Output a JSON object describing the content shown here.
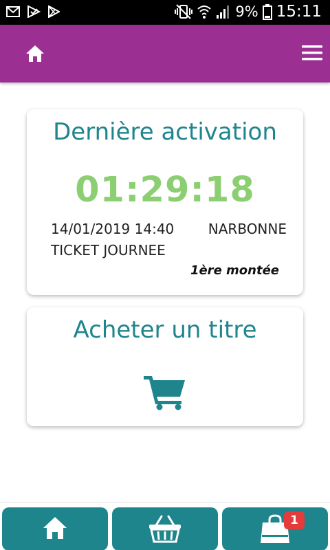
{
  "status_bar": {
    "battery_percent": "9%",
    "time": "15:11",
    "icons": [
      "gmail-icon",
      "play-store-check-icon",
      "play-store-icon",
      "vibrate-icon",
      "wifi-icon",
      "signal-icon",
      "battery-low-icon"
    ]
  },
  "header": {
    "background_color": "#9b2f92",
    "icons": [
      "home-icon",
      "menu-icon"
    ]
  },
  "activation_card": {
    "title": "Dernière activation",
    "timer": "01:29:18",
    "datetime": "14/01/2019 14:40",
    "city": "NARBONNE",
    "ticket_type": "TICKET JOURNEE",
    "boarding": "1ère montée"
  },
  "purchase_card": {
    "title": "Acheter un titre",
    "icon": "cart-icon"
  },
  "bottom_nav": {
    "accent_color": "#1f858c",
    "items": [
      {
        "icon": "home-icon"
      },
      {
        "icon": "basket-icon"
      },
      {
        "icon": "shopping-bag-icon",
        "badge": "1"
      }
    ]
  },
  "colors": {
    "title": "#1f858c",
    "timer": "#8ccf72",
    "badge": "#e53b3b"
  }
}
